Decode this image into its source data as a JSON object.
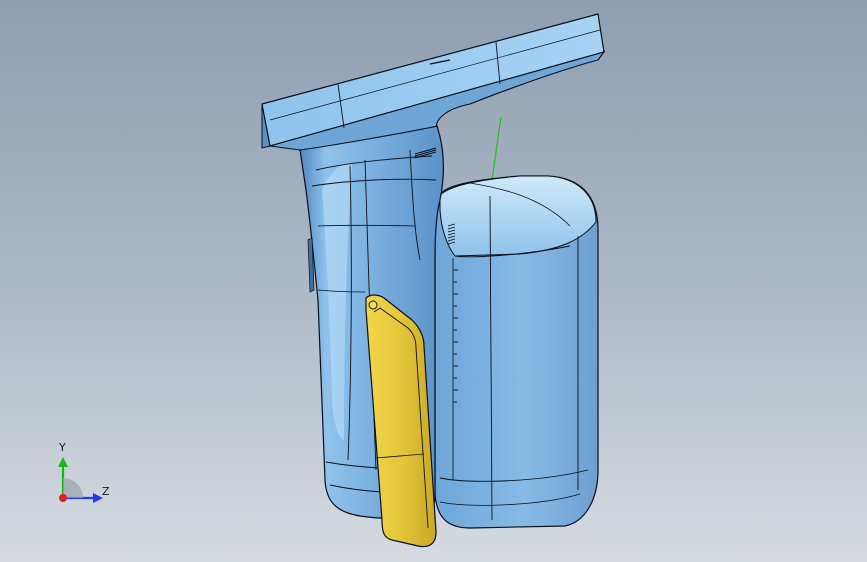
{
  "triad": {
    "y_label": "Y",
    "z_label": "Z"
  },
  "colors": {
    "background_top": "#8f9fb1",
    "background_bottom": "#d6dbe1",
    "body_surface": "#7fb3e2",
    "body_shadow": "#4f86bd",
    "body_highlight": "#bfe0f7",
    "bracket_surface": "#e0c337",
    "edge_line": "#0b0f18",
    "guide_line": "#22c21c",
    "axis_x": "#e01e1e",
    "axis_y": "#18b818",
    "axis_z": "#1e3de0"
  }
}
